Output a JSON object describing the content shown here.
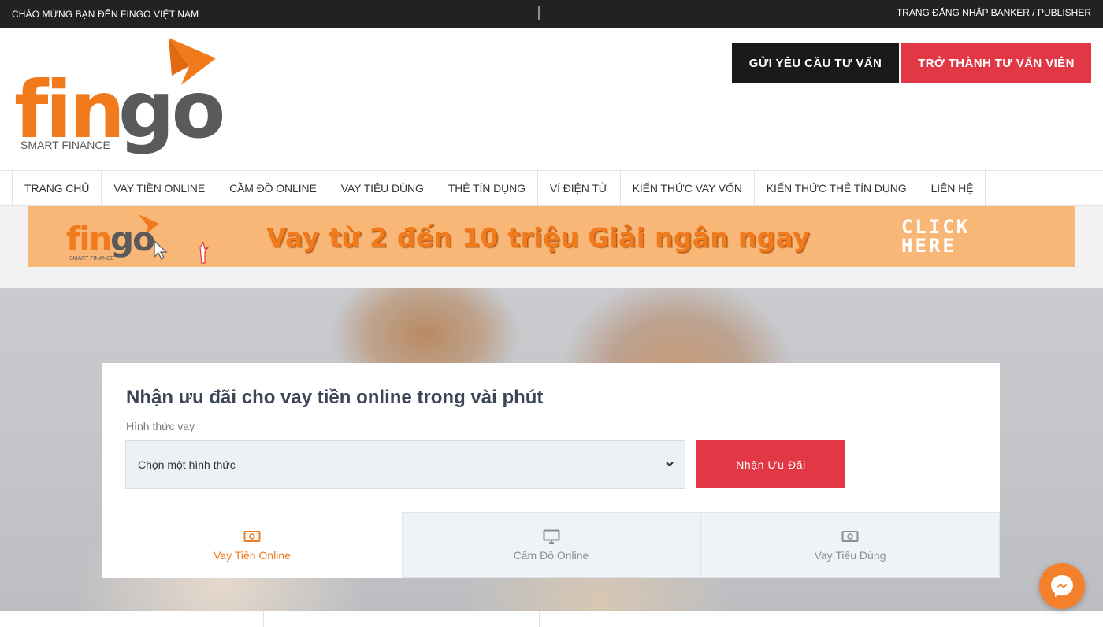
{
  "topbar": {
    "welcome": "CHÀO MỪNG BẠN ĐẾN FINGO VIỆT NAM",
    "login": "TRANG ĐĂNG NHẬP BANKER / PUBLISHER"
  },
  "header": {
    "logo_text": "fingo",
    "logo_tagline": "SMART FINANCE",
    "consult_button": "GỬI YÊU CẦU TƯ VẤN",
    "advisor_button": "TRỞ THÀNH TƯ VẤN VIÊN"
  },
  "nav": {
    "items": [
      {
        "label": "TRANG CHỦ"
      },
      {
        "label": "VAY TIỀN ONLINE"
      },
      {
        "label": "CẦM ĐỒ ONLINE"
      },
      {
        "label": "VAY TIÊU DÙNG"
      },
      {
        "label": "THẺ TÍN DỤNG"
      },
      {
        "label": "VÍ ĐIỆN TỬ"
      },
      {
        "label": "KIẾN THỨC VAY VỐN"
      },
      {
        "label": "KIẾN THỨC THẺ TÍN DỤNG"
      },
      {
        "label": "LIÊN HỆ"
      }
    ]
  },
  "banner": {
    "logo_text": "fingo",
    "logo_tagline": "SMART FINANCE",
    "text_1": "Vay từ 2 đến 10 triệu",
    "text_2": "Giải ngân ngay",
    "click_line_1": "CLICK",
    "click_line_2": "HERE"
  },
  "form": {
    "title": "Nhận ưu đãi cho vay tiền online trong vài phút",
    "label": "Hình thức vay",
    "select_value": "Chọn một hình thức",
    "submit": "Nhận Ưu Đãi",
    "tabs": [
      {
        "label": "Vay Tiền Online",
        "icon": "money-icon",
        "active": true
      },
      {
        "label": "Cầm Đồ Online",
        "icon": "monitor-icon",
        "active": false
      },
      {
        "label": "Vay Tiêu Dùng",
        "icon": "money-icon",
        "active": false
      }
    ]
  },
  "colors": {
    "brand_orange": "#f07a1c",
    "accent_red": "#e23744",
    "dark": "#1a1a1a",
    "logo_gray": "#5a5a5a"
  }
}
